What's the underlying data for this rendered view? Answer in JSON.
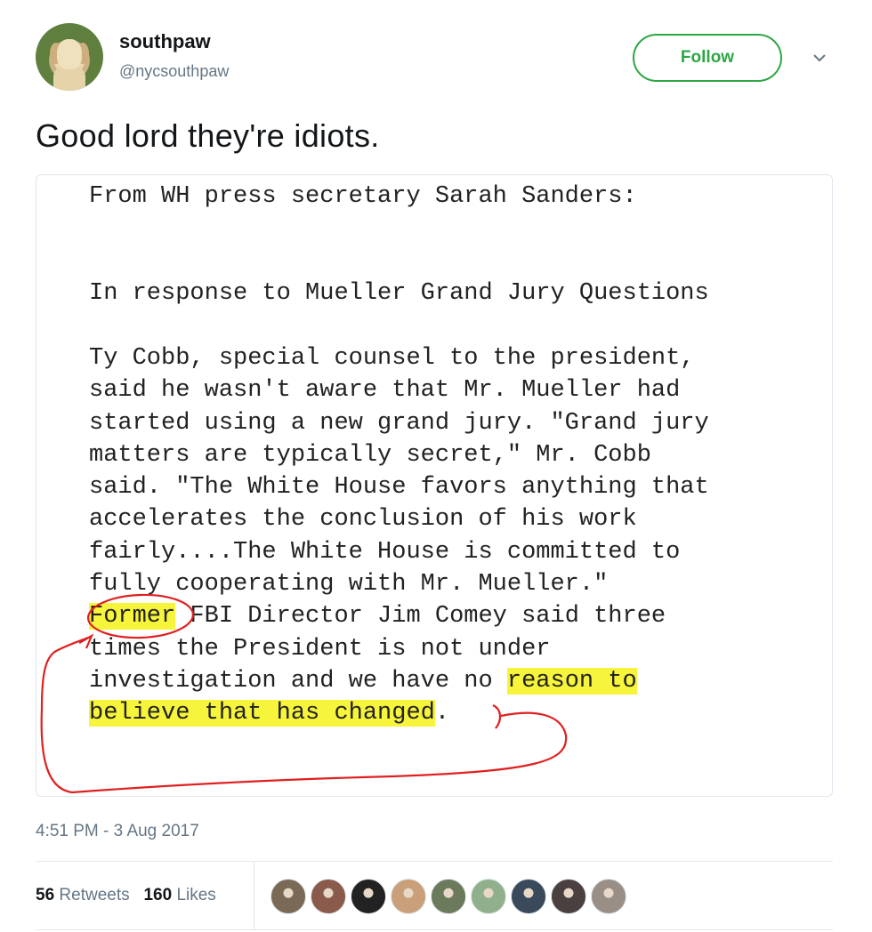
{
  "user": {
    "name": "southpaw",
    "handle": "@nycsouthpaw",
    "follow_label": "Follow"
  },
  "tweet": {
    "text": "Good lord they're idiots.",
    "timestamp": "4:51 PM - 3 Aug 2017"
  },
  "document": {
    "line1": "From WH press secretary Sarah Sanders:",
    "line2": "In response to Mueller Grand Jury Questions",
    "para": [
      "Ty Cobb, special counsel to the president,",
      "said he wasn't aware that Mr. Mueller had",
      "started using a new grand jury. \"Grand jury",
      "matters are typically secret,\" Mr. Cobb",
      "said. \"The White House favors anything that",
      "accelerates the conclusion of his work",
      "fairly....The White House is committed to",
      "fully cooperating with Mr. Mueller.\""
    ],
    "hl_former": "Former",
    "after_former": " FBI Director Jim Comey said three",
    "line_times": "times the President is not under",
    "line_invest_pre": "investigation and we have no ",
    "hl_reason": "reason to",
    "hl_believe": "believe that has changed",
    "period": "."
  },
  "stats": {
    "retweets_count": "56",
    "retweets_label": "Retweets",
    "likes_count": "160",
    "likes_label": "Likes"
  },
  "liker_avatars": [
    "#7a6a55",
    "#8a5a4a",
    "#222222",
    "#c9a07a",
    "#6b7a5a",
    "#8fb08a",
    "#3a4a5a",
    "#4a4040",
    "#9a8f86"
  ],
  "colors": {
    "follow_green": "#2ea643",
    "highlight": "#f7f43c",
    "annotation_red": "#e02020"
  }
}
